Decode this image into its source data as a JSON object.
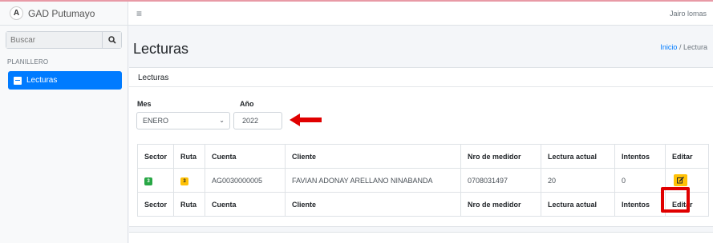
{
  "sidebar": {
    "brand": "GAD Putumayo",
    "brand_logo": "A",
    "search_placeholder": "Buscar",
    "section_header": "PLANILLERO",
    "items": [
      {
        "label": "Lecturas",
        "icon": "book-icon",
        "active": true
      }
    ]
  },
  "navbar": {
    "user": "Jairo lomas"
  },
  "header": {
    "title": "Lecturas",
    "breadcrumb_home": "Inicio",
    "breadcrumb_sep": "/",
    "breadcrumb_current": "Lectura"
  },
  "card": {
    "title": "Lecturas",
    "mes_label": "Mes",
    "mes_value": "ENERO",
    "anio_label": "Año",
    "anio_value": "2022"
  },
  "table": {
    "headers": [
      "Sector",
      "Ruta",
      "Cuenta",
      "Cliente",
      "Nro de medidor",
      "Lectura actual",
      "Intentos",
      "Editar"
    ],
    "rows": [
      {
        "sector": "3",
        "ruta": "3",
        "cuenta": "AG0030000005",
        "cliente": "FAVIAN ADONAY ARELLANO NINABANDA",
        "medidor": "0708031497",
        "lectura": "20",
        "intentos": "0"
      }
    ]
  },
  "colors": {
    "primary": "#007bff",
    "success": "#28a745",
    "warning": "#ffc107",
    "annotation": "#e00000"
  }
}
